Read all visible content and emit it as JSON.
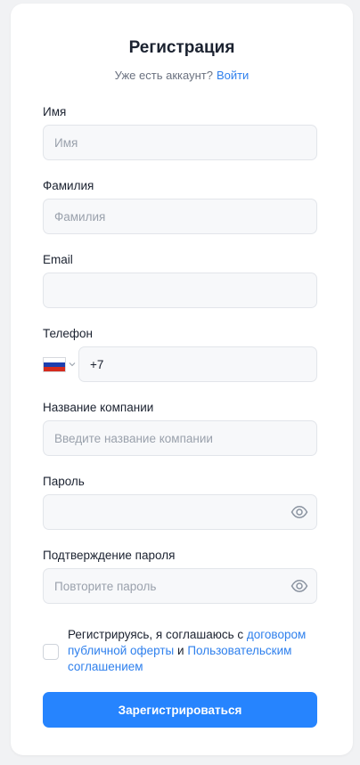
{
  "header": {
    "title": "Регистрация",
    "subtitle_text": "Уже есть аккаунт?",
    "login_link": "Войти"
  },
  "fields": {
    "first_name": {
      "label": "Имя",
      "placeholder": "Имя",
      "value": ""
    },
    "last_name": {
      "label": "Фамилия",
      "placeholder": "Фамилия",
      "value": ""
    },
    "email": {
      "label": "Email",
      "placeholder": "",
      "value": ""
    },
    "phone": {
      "label": "Телефон",
      "country": "RU",
      "value": "+7"
    },
    "company": {
      "label": "Название компании",
      "placeholder": "Введите название компании",
      "value": ""
    },
    "password": {
      "label": "Пароль",
      "placeholder": "",
      "value": ""
    },
    "password_confirm": {
      "label": "Подтверждение пароля",
      "placeholder": "Повторите пароль",
      "value": ""
    }
  },
  "consent": {
    "checked": false,
    "text_before": "Регистрируясь, я соглашаюсь с ",
    "offer_link": "договором публичной оферты",
    "text_middle": " и ",
    "terms_link": "Пользовательским соглашением"
  },
  "submit_label": "Зарегистрироваться",
  "colors": {
    "accent": "#2684fe",
    "link": "#2f80ed",
    "input_bg": "#f7f8fa",
    "input_border": "#e2e5ea",
    "page_bg": "#f1f2f4"
  },
  "icons": {
    "password_toggle": "eye-icon",
    "password_confirm_toggle": "eye-icon",
    "country_dropdown": "chevron-down-icon",
    "country_flag": "russia-flag-icon"
  }
}
